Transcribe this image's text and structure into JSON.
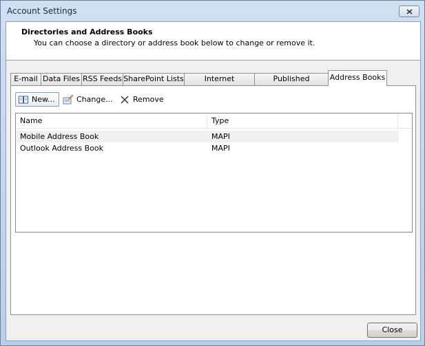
{
  "window": {
    "title": "Account Settings"
  },
  "header": {
    "title": "Directories and Address Books",
    "subtitle": "You can choose a directory or address book below to change or remove it."
  },
  "tabs": [
    {
      "label": "E-mail"
    },
    {
      "label": "Data Files"
    },
    {
      "label": "RSS Feeds"
    },
    {
      "label": "SharePoint Lists"
    },
    {
      "label": "Internet Calendars"
    },
    {
      "label": "Published Calendars"
    },
    {
      "label": "Address Books",
      "active": true
    }
  ],
  "toolbar": {
    "new_label": "New...",
    "change_label": "Change...",
    "remove_label": "Remove"
  },
  "list": {
    "columns": [
      "Name",
      "Type"
    ],
    "rows": [
      {
        "name": "Mobile Address Book",
        "type": "MAPI",
        "selected": true
      },
      {
        "name": "Outlook Address Book",
        "type": "MAPI",
        "selected": false
      }
    ]
  },
  "footer": {
    "close_label": "Close"
  },
  "colors": {
    "title_bar": "#cfe0f3",
    "panel": "#f0f0f0",
    "selection": "#f0f0f0"
  }
}
